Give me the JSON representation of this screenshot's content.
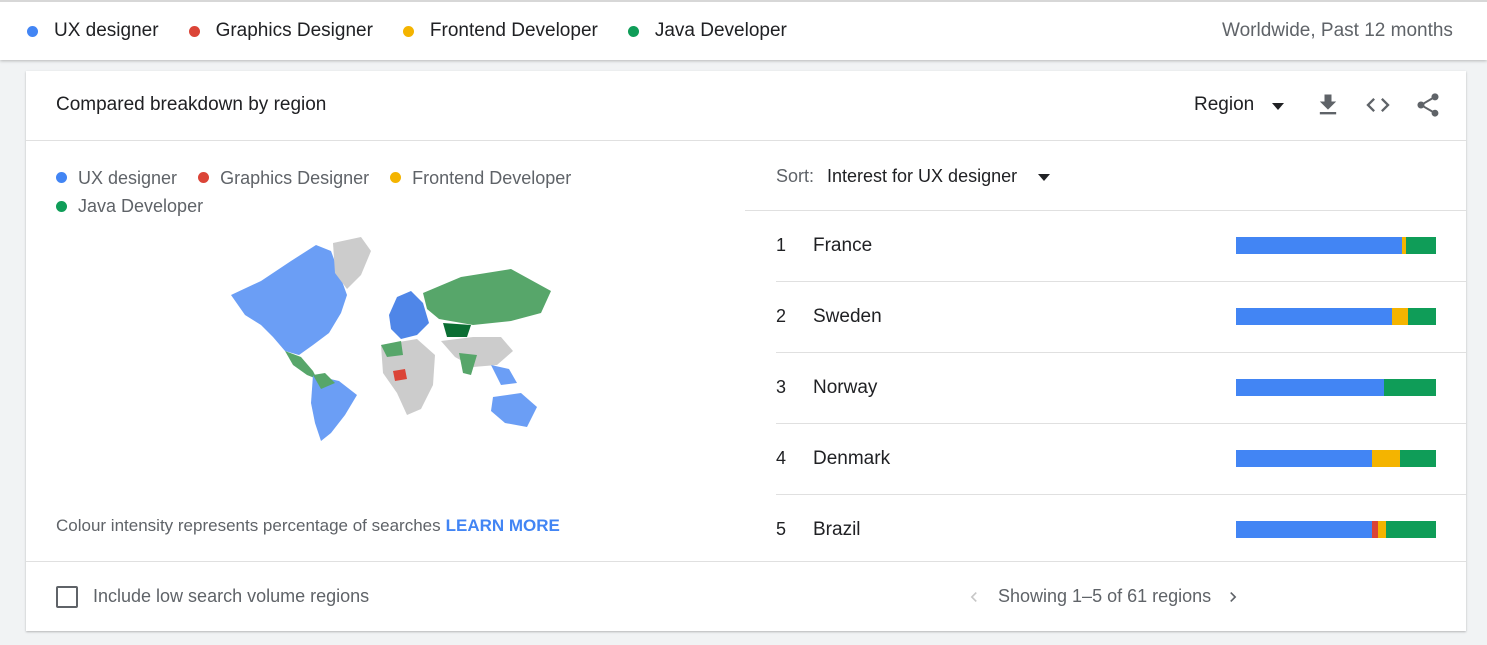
{
  "top_legend": {
    "terms": [
      {
        "label": "UX designer",
        "color": "#4285f4"
      },
      {
        "label": "Graphics Designer",
        "color": "#db4437"
      },
      {
        "label": "Frontend Developer",
        "color": "#f4b400"
      },
      {
        "label": "Java Developer",
        "color": "#0f9d58"
      }
    ],
    "scope": "Worldwide, Past 12 months"
  },
  "card": {
    "title": "Compared breakdown by region",
    "region_select": "Region",
    "icons": [
      "download-icon",
      "embed-code-icon",
      "share-icon"
    ],
    "map_legend": [
      {
        "label": "UX designer",
        "color": "#4285f4"
      },
      {
        "label": "Graphics Designer",
        "color": "#db4437"
      },
      {
        "label": "Frontend Developer",
        "color": "#f4b400"
      },
      {
        "label": "Java Developer",
        "color": "#0f9d58"
      }
    ],
    "map_note": "Colour intensity represents percentage of searches",
    "learn_more": "LEARN MORE",
    "sort_label": "Sort:",
    "sort_value": "Interest for UX designer",
    "regions": [
      {
        "rank": "1",
        "name": "France",
        "shares": [
          0.83,
          0.0,
          0.02,
          0.15
        ]
      },
      {
        "rank": "2",
        "name": "Sweden",
        "shares": [
          0.78,
          0.0,
          0.08,
          0.14
        ]
      },
      {
        "rank": "3",
        "name": "Norway",
        "shares": [
          0.74,
          0.0,
          0.0,
          0.26
        ]
      },
      {
        "rank": "4",
        "name": "Denmark",
        "shares": [
          0.68,
          0.0,
          0.14,
          0.18
        ]
      },
      {
        "rank": "5",
        "name": "Brazil",
        "shares": [
          0.68,
          0.03,
          0.04,
          0.25
        ]
      }
    ],
    "footer": {
      "checkbox_label": "Include low search volume regions",
      "pager_text": "Showing 1–5 of 61 regions"
    }
  }
}
